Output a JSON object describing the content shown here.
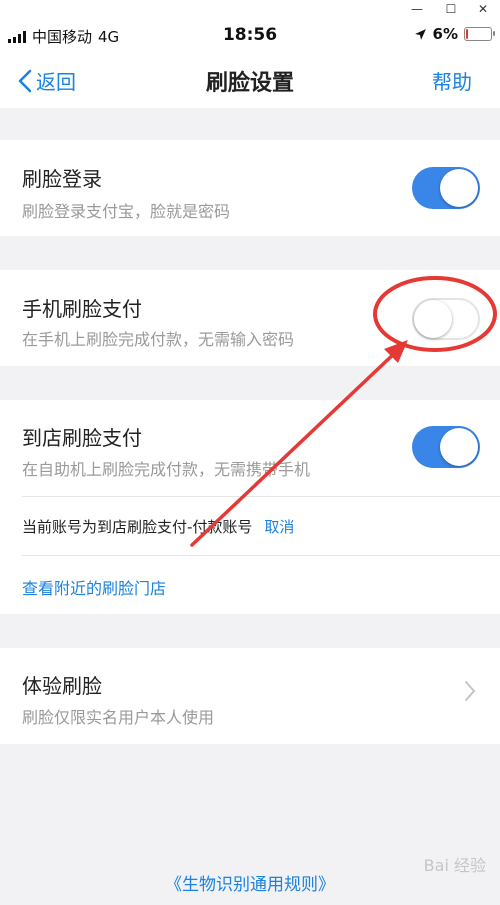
{
  "window_controls": {
    "minimize": "—",
    "maximize": "☐",
    "close": "✕"
  },
  "status_bar": {
    "carrier": "中国移动",
    "network": "4G",
    "time": "18:56",
    "battery": "6%",
    "battery_level": 0.06
  },
  "nav": {
    "back_label": "返回",
    "title": "刷脸设置",
    "help_label": "帮助"
  },
  "face_login": {
    "title": "刷脸登录",
    "subtitle": "刷脸登录支付宝，脸就是密码",
    "enabled": true
  },
  "phone_pay": {
    "title": "手机刷脸支付",
    "subtitle": "在手机上刷脸完成付款，无需输入密码",
    "enabled": false
  },
  "store_pay": {
    "title": "到店刷脸支付",
    "subtitle": "在自助机上刷脸完成付款，无需携带手机",
    "enabled": true,
    "account_text": "当前账号为到店刷脸支付-付款账号",
    "cancel_label": "取消",
    "nearby_link": "查看附近的刷脸门店"
  },
  "experience": {
    "title": "体验刷脸",
    "subtitle": "刷脸仅限实名用户本人使用"
  },
  "footer": {
    "rules_link": "《生物识别通用规则》"
  },
  "watermark": "Bai 经验",
  "colors": {
    "accent": "#1a82e0",
    "toggle_on": "#3a86e8",
    "annotation": "#e53935"
  }
}
